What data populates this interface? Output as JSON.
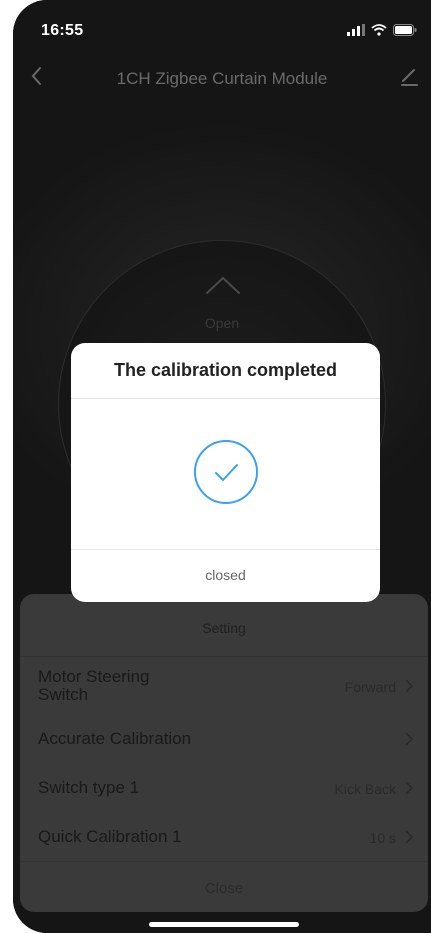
{
  "status_bar": {
    "time": "16:55"
  },
  "nav": {
    "title": "1CH Zigbee Curtain Module"
  },
  "control": {
    "open_label": "Open"
  },
  "settings_sheet": {
    "title": "Setting",
    "rows": [
      {
        "label": "Motor Steering\nSwitch",
        "value": "Forward"
      },
      {
        "label": "Accurate Calibration",
        "value": ""
      },
      {
        "label": "Switch type 1",
        "value": "Kick Back"
      },
      {
        "label": "Quick Calibration 1",
        "value": "10 s"
      }
    ],
    "close_label": "Close"
  },
  "dialog": {
    "title": "The calibration completed",
    "button_label": "closed",
    "icon": "check-circle-icon",
    "accent_color": "#3aa0f5"
  }
}
